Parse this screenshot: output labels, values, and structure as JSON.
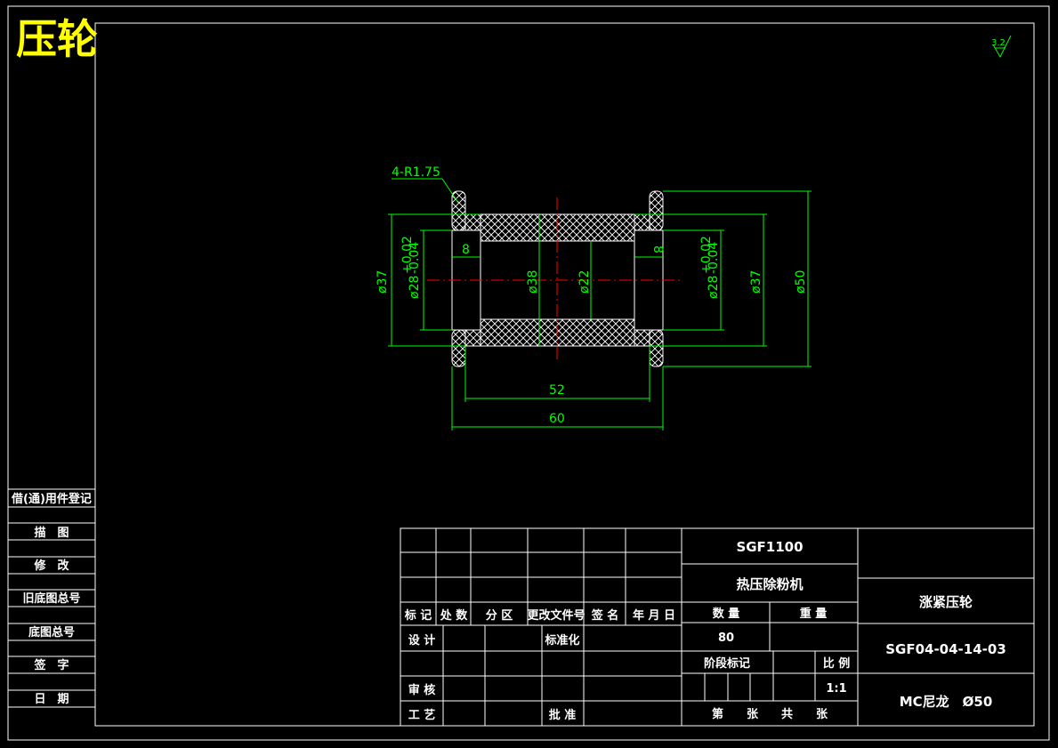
{
  "drawing_title": "压轮",
  "roughness": "3.2",
  "left_panel": [
    "借(通)用件登记",
    "描　图",
    "修　改",
    "旧底图总号",
    "底图总号",
    "签　字",
    "日　期"
  ],
  "dimensions": {
    "radius_note": "4-R1.75",
    "d37_left": "ø37",
    "d28_left": "ø28",
    "d28_tol_up": "+0.02",
    "d28_tol_low": "-0.04",
    "width8_left": "8",
    "d38": "ø38",
    "d22": "ø22",
    "width8_right": "8",
    "d28_right": "ø28",
    "d37_right": "ø37",
    "d50": "ø50",
    "len52": "52",
    "len60": "60"
  },
  "title_block": {
    "headers": [
      "标 记",
      "处 数",
      "分 区",
      "更改文件号",
      "签 名",
      "年 月 日"
    ],
    "design": "设 计",
    "standardize": "标准化",
    "review": "审 核",
    "process": "工 艺",
    "approve": "批 准",
    "project_code": "SGF1100",
    "machine": "热压除粉机",
    "qty_label": "数 量",
    "weight_label": "重 量",
    "qty": "80",
    "stage_label": "阶段标记",
    "scale_label": "比 例",
    "scale": "1:1",
    "sheet_label": "第　　张　　共　　张",
    "part_name": "涨紧压轮",
    "part_no": "SGF04-04-14-03",
    "material": "MC尼龙　Ø50"
  }
}
